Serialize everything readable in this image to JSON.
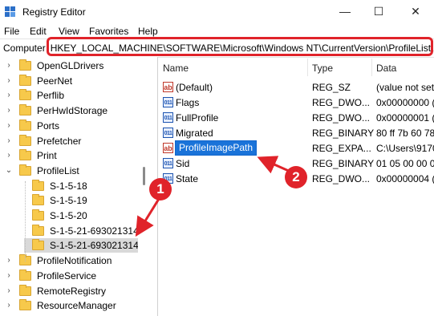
{
  "window": {
    "title": "Registry Editor",
    "controls": [
      "minimize",
      "maximize",
      "close"
    ]
  },
  "menu": [
    "File",
    "Edit",
    "View",
    "Favorites",
    "Help"
  ],
  "address": {
    "prefix": "Computer",
    "path": "HKEY_LOCAL_MACHINE\\SOFTWARE\\Microsoft\\Windows NT\\CurrentVersion\\ProfileList\\S"
  },
  "tree": {
    "items": [
      {
        "label": "OpenGLDrivers",
        "expanded": false,
        "level": 1
      },
      {
        "label": "PeerNet",
        "expanded": false,
        "level": 1
      },
      {
        "label": "Perflib",
        "expanded": false,
        "level": 1
      },
      {
        "label": "PerHwIdStorage",
        "expanded": false,
        "level": 1
      },
      {
        "label": "Ports",
        "expanded": false,
        "level": 1
      },
      {
        "label": "Prefetcher",
        "expanded": false,
        "level": 1
      },
      {
        "label": "Print",
        "expanded": false,
        "level": 1
      },
      {
        "label": "ProfileList",
        "expanded": true,
        "level": 1
      },
      {
        "label": "S-1-5-18",
        "expanded": false,
        "level": 2
      },
      {
        "label": "S-1-5-19",
        "expanded": false,
        "level": 2
      },
      {
        "label": "S-1-5-20",
        "expanded": false,
        "level": 2
      },
      {
        "label": "S-1-5-21-693021314",
        "expanded": false,
        "level": 2
      },
      {
        "label": "S-1-5-21-693021314-",
        "expanded": false,
        "level": 2,
        "selected": true
      },
      {
        "label": "ProfileNotification",
        "expanded": false,
        "level": 1
      },
      {
        "label": "ProfileService",
        "expanded": false,
        "level": 1
      },
      {
        "label": "RemoteRegistry",
        "expanded": false,
        "level": 1
      },
      {
        "label": "ResourceManager",
        "expanded": false,
        "level": 1
      }
    ]
  },
  "values": {
    "columns": [
      "Name",
      "Type",
      "Data"
    ],
    "rows": [
      {
        "icon": "string-value-icon",
        "name": "(Default)",
        "type": "REG_SZ",
        "data": "(value not set"
      },
      {
        "icon": "binary-value-icon",
        "name": "Flags",
        "type": "REG_DWO...",
        "data": "0x00000000 (0"
      },
      {
        "icon": "binary-value-icon",
        "name": "FullProfile",
        "type": "REG_DWO...",
        "data": "0x00000001 ("
      },
      {
        "icon": "binary-value-icon",
        "name": "Migrated",
        "type": "REG_BINARY",
        "data": "80 ff 7b 60 78"
      },
      {
        "icon": "string-value-icon",
        "name": "ProfileImagePath",
        "type": "REG_EXPA...",
        "data": "C:\\Users\\9170",
        "editing": true
      },
      {
        "icon": "binary-value-icon",
        "name": "Sid",
        "type": "REG_BINARY",
        "data": "01 05 00 00 00"
      },
      {
        "icon": "binary-value-icon",
        "name": "State",
        "type": "REG_DWO...",
        "data": "0x00000004 (4"
      }
    ]
  },
  "annotations": {
    "callout_1": "1",
    "callout_2": "2",
    "accent_color": "#e0232a"
  },
  "icon_glyphs": {
    "string": "ab",
    "binary": "011"
  }
}
